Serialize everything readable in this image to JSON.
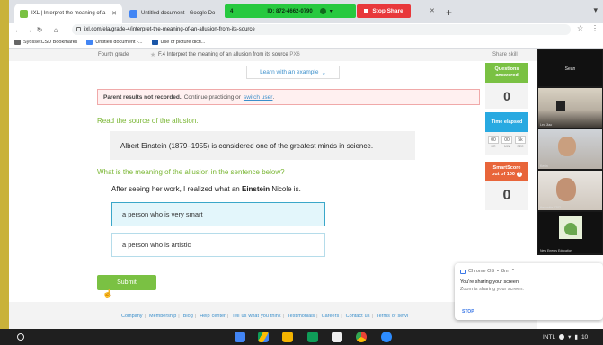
{
  "tabs": [
    {
      "label": "IXL | Interpret the meaning of a",
      "active": true
    },
    {
      "label": "Untitled document - Google Do",
      "active": false
    }
  ],
  "zoom_share": {
    "number": "4",
    "meeting_id": "ID: 872-4662-0790",
    "stop_label": "Stop Share"
  },
  "address": {
    "url": "ixl.com/ela/grade-4/interpret-the-meaning-of-an-allusion-from-its-source"
  },
  "bookmarks": [
    "SyossetCSD Bookmarks",
    "Untitled document -...",
    "Use of picture dicti..."
  ],
  "breadcrumb": {
    "grade": "Fourth grade",
    "skill": "F.4 Interpret the meaning of an allusion from its source",
    "code": "PX6",
    "share": "Share skill"
  },
  "learn_label": "Learn with an example",
  "notice": {
    "bold": "Parent results not recorded.",
    "text": "Continue practicing or",
    "link": "switch user",
    "end": "."
  },
  "question1": "Read the source of the allusion.",
  "source_text": "Albert Einstein (1879–1955) is considered one of the greatest minds in science.",
  "question2": "What is the meaning of the allusion in the sentence below?",
  "sentence": {
    "before": "After seeing her work, I realized what an",
    "bold": "Einstein",
    "after": "Nicole is."
  },
  "choices": [
    "a person who is very smart",
    "a person who is artistic"
  ],
  "submit_label": "Submit",
  "stats": {
    "questions_label": "Questions answered",
    "questions_value": "0",
    "time_label": "Time elapsed",
    "time": [
      {
        "v": "00",
        "l": "HR"
      },
      {
        "v": "00",
        "l": "MIN"
      },
      {
        "v": "5k",
        "l": "SEC"
      }
    ],
    "smartscore_label": "SmartScore",
    "smartscore_sub": "out of 100",
    "smartscore_value": "0"
  },
  "footer_links": [
    "Company",
    "Membership",
    "Blog",
    "Help center",
    "Tell us what you think",
    "Testimonials",
    "Careers",
    "Contact us",
    "Terms of servi"
  ],
  "video": {
    "host": "Sean",
    "names": [
      "Leo Jiao",
      "Kevin",
      "thefunkie 1203",
      "New Energy Education"
    ]
  },
  "toast": {
    "app": "Chrome OS",
    "time": "8m",
    "line1": "You're sharing your screen",
    "line2": "Zoom is sharing your screen.",
    "stop": "STOP"
  },
  "tray": {
    "lang": "INTL",
    "time": "10"
  },
  "colors": {
    "ixl_green": "#7ac143",
    "ixl_blue": "#3b8fcb",
    "zoom_green": "#27c93f",
    "stop_red": "#e8383b"
  }
}
